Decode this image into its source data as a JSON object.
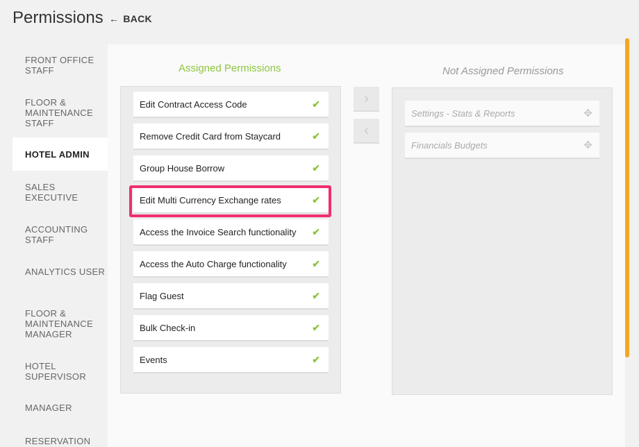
{
  "header": {
    "title": "Permissions",
    "back_label": "BACK"
  },
  "sidebar": {
    "items": [
      {
        "label": "FRONT OFFICE STAFF"
      },
      {
        "label": "FLOOR & MAINTENANCE STAFF"
      },
      {
        "label": "HOTEL ADMIN",
        "active": true
      },
      {
        "label": "SALES EXECUTIVE"
      },
      {
        "label": "ACCOUNTING STAFF"
      },
      {
        "label": "ANALYTICS USER"
      },
      {
        "label": "FLOOR & MAINTENANCE MANAGER"
      },
      {
        "label": "HOTEL SUPERVISOR"
      },
      {
        "label": "MANAGER"
      },
      {
        "label": "RESERVATION"
      }
    ]
  },
  "assigned": {
    "title": "Assigned Permissions",
    "items": [
      "Edit Contract Access Code",
      "Remove Credit Card from Staycard",
      "Group House Borrow",
      "Edit Multi Currency Exchange rates",
      "Access the Invoice Search functionality",
      "Access the Auto Charge functionality",
      "Flag Guest",
      "Bulk Check-in",
      "Events"
    ],
    "highlighted": "Edit Multi Currency Exchange rates"
  },
  "not_assigned": {
    "title": "Not Assigned Permissions",
    "items": [
      "Settings - Stats & Reports",
      "Financials Budgets"
    ]
  },
  "controls": {
    "move_right_icon": "chevron-right-icon",
    "move_left_icon": "chevron-left-icon"
  },
  "colors": {
    "accent_green": "#8dc63f",
    "highlight": "#ef2e6e",
    "scrollbar": "#f5a623"
  }
}
